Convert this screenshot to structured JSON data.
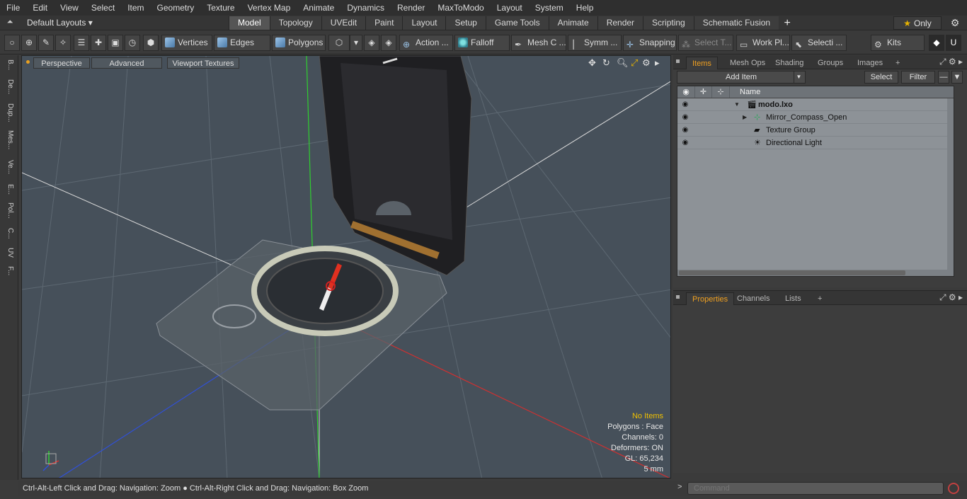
{
  "menu": [
    "File",
    "Edit",
    "View",
    "Select",
    "Item",
    "Geometry",
    "Texture",
    "Vertex Map",
    "Animate",
    "Dynamics",
    "Render",
    "MaxToModo",
    "Layout",
    "System",
    "Help"
  ],
  "layout": {
    "dropdown_label": "Default Layouts ▾"
  },
  "tabs": [
    "Model",
    "Topology",
    "UVEdit",
    "Paint",
    "Layout",
    "Setup",
    "Game Tools",
    "Animate",
    "Render",
    "Scripting",
    "Schematic Fusion"
  ],
  "active_tab": "Model",
  "only_label": "Only",
  "toolbar": {
    "vertices": "Vertices",
    "edges": "Edges",
    "polygons": "Polygons",
    "action": "Action ...",
    "falloff": "Falloff",
    "mesh": "Mesh C ...",
    "symm": "Symm ...",
    "snapping": "Snapping",
    "select_t": "Select T...",
    "work_pl": "Work Pl...",
    "selecti": "Selecti ...",
    "kits": "Kits"
  },
  "left_strip": [
    "B...",
    "De...",
    "Dup...",
    "Mes...",
    "Ve...",
    "E...",
    "Pol...",
    "C...",
    "UV",
    "F..."
  ],
  "viewport": {
    "perspective": "Perspective",
    "advanced": "Advanced",
    "viewport_textures": "Viewport Textures",
    "stats": {
      "items": "No Items",
      "polygons": "Polygons : Face",
      "channels": "Channels: 0",
      "deformers": "Deformers: ON",
      "gl": "GL: 65,234",
      "scale": "5 mm"
    }
  },
  "status": "Ctrl-Alt-Left Click and Drag: Navigation: Zoom ● Ctrl-Alt-Right Click and Drag: Navigation: Box Zoom",
  "items_panel": {
    "tabs": [
      "Items",
      "Mesh Ops",
      "Shading",
      "Groups",
      "Images"
    ],
    "add_item": "Add Item",
    "select": "Select",
    "filter": "Filter",
    "name_col": "Name",
    "rows": [
      {
        "label": "modo.lxo",
        "bold": true
      },
      {
        "label": "Mirror_Compass_Open"
      },
      {
        "label": "Texture Group"
      },
      {
        "label": "Directional Light"
      }
    ]
  },
  "properties_panel": {
    "tabs": [
      "Properties",
      "Channels",
      "Lists"
    ]
  },
  "command": {
    "placeholder": "Command"
  }
}
